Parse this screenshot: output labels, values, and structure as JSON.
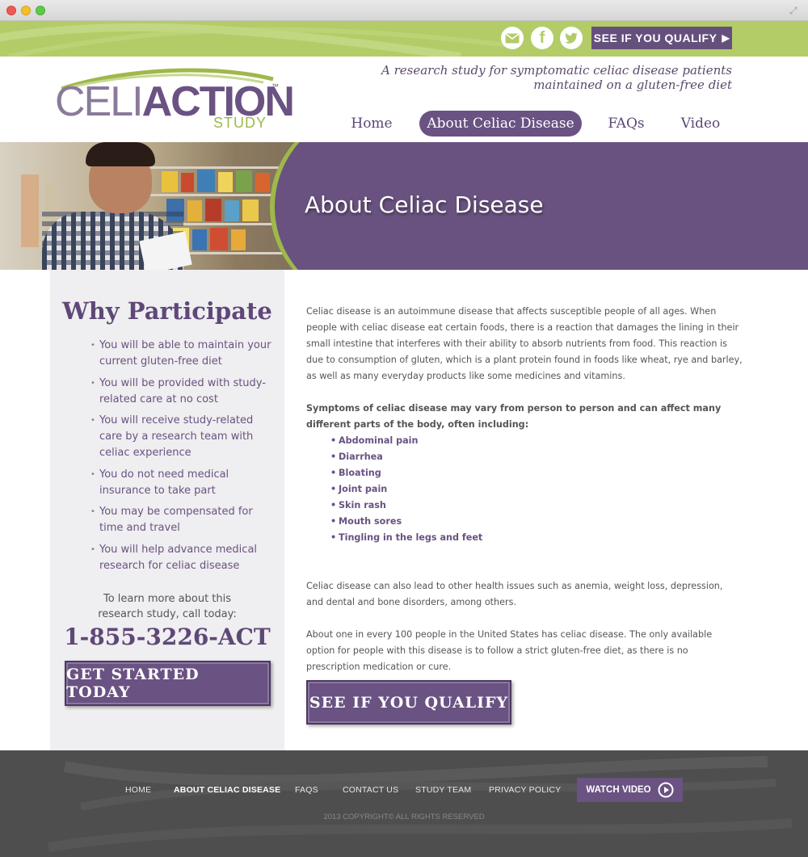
{
  "header": {
    "qualify_button": "SEE IF YOU QUALIFY",
    "tagline_line1": "A research study for symptomatic celiac disease patients",
    "tagline_line2": "maintained on a gluten-free diet",
    "logo": {
      "celi": "CELI",
      "action": "ACTION",
      "study": "STUDY",
      "tm": "™"
    },
    "social_icons": [
      "email-icon",
      "facebook-icon",
      "twitter-icon"
    ]
  },
  "nav": {
    "items": [
      {
        "label": "Home",
        "active": false
      },
      {
        "label": "About Celiac Disease",
        "active": true
      },
      {
        "label": "FAQs",
        "active": false
      },
      {
        "label": "Video",
        "active": false
      }
    ]
  },
  "hero": {
    "title": "About Celiac Disease"
  },
  "sidebar": {
    "title": "Why Participate",
    "items": [
      "You will be able to maintain your current gluten-free diet",
      "You will be provided with study-related care at no cost",
      "You will receive study-related care by a research team with celiac experience",
      "You do not need medical insurance to take part",
      "You may be compensated for time and travel",
      "You will help advance medical research for celiac disease"
    ],
    "learn_more": "To learn more about this research study, call today:",
    "phone": "1-855-3226-ACT",
    "cta": "GET STARTED TODAY"
  },
  "content": {
    "para1": "Celiac disease is an autoimmune disease that affects susceptible people of all ages. When people with celiac disease eat certain foods, there is a reaction that damages the lining in their small intestine that interferes with their ability to absorb nutrients from food. This reaction is due to consumption of gluten, which is a plant protein found in foods like wheat, rye and barley, as well as many everyday products like some medicines and vitamins.",
    "symptoms_intro": "Symptoms of celiac disease may vary from person to person and can affect many different parts of the body, often including:",
    "symptoms": [
      "Abdominal pain",
      "Diarrhea",
      "Bloating",
      "Joint pain",
      "Skin rash",
      "Mouth sores",
      "Tingling in the legs and feet"
    ],
    "para2": "Celiac disease can also lead to other health issues such as anemia, weight loss, depression, and dental and bone disorders, among others.",
    "para3": "About one in every 100 people in the United States has celiac disease. The only available option for people with this disease is to follow a strict gluten-free diet, as there is no prescription medication or cure.",
    "cta": "SEE IF YOU QUALIFY"
  },
  "footer": {
    "links": [
      {
        "label": "HOME",
        "active": false
      },
      {
        "label": "ABOUT CELIAC DISEASE",
        "active": true
      },
      {
        "label": "FAQS",
        "active": false
      },
      {
        "label": "CONTACT US",
        "active": false
      },
      {
        "label": "STUDY TEAM",
        "active": false
      },
      {
        "label": "PRIVACY POLICY",
        "active": false
      }
    ],
    "watch_video": "WATCH VIDEO",
    "copyright": "2013 COPYRIGHT© ALL RIGHTS RESERVED"
  },
  "colors": {
    "purple": "#6a5282",
    "green": "#b3cc68",
    "footer": "#4e4e4e"
  }
}
